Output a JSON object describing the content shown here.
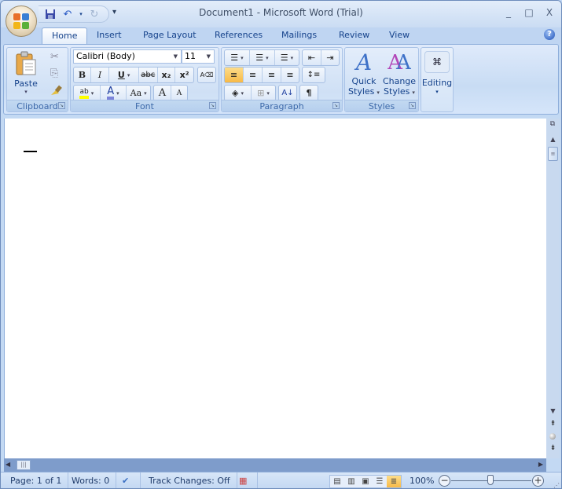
{
  "window": {
    "title": "Document1 - Microsoft Word (Trial)",
    "minimize": "_",
    "maximize": "□",
    "close": "X"
  },
  "qat": {
    "save": "save-icon",
    "undo": "undo-icon",
    "redo": "redo-icon",
    "customize": "▾"
  },
  "tabs": [
    "Home",
    "Insert",
    "Page Layout",
    "References",
    "Mailings",
    "Review",
    "View"
  ],
  "active_tab": "Home",
  "help": "?",
  "clipboard": {
    "label": "Clipboard",
    "paste": "Paste",
    "cut": "✂",
    "copy": "⎘",
    "format_painter": "🖌"
  },
  "font": {
    "label": "Font",
    "name": "Calibri (Body)",
    "size": "11",
    "bold": "B",
    "italic": "I",
    "underline": "U",
    "strike": "abc",
    "subscript": "x₂",
    "superscript": "x²",
    "clear": "A⌫",
    "highlight": "ab",
    "font_color": "A",
    "change_case": "Aa",
    "grow": "A",
    "shrink": "A",
    "highlight_color": "#ffff00",
    "font_color_value": "#7b83d9"
  },
  "paragraph": {
    "label": "Paragraph",
    "bullets": "☰",
    "numbering": "☰",
    "multilevel": "☰",
    "decrease_indent": "⇤",
    "increase_indent": "⇥",
    "align_left": "≡",
    "center": "≡",
    "align_right": "≡",
    "justify": "≡",
    "line_spacing": "↕≡",
    "shading": "◈",
    "borders": "⊞",
    "sort": "A↓",
    "pilcrow": "¶"
  },
  "styles": {
    "label": "Styles",
    "quick": "Quick",
    "quick2": "Styles",
    "change": "Change",
    "change2": "Styles"
  },
  "editing": {
    "label": "Editing"
  },
  "status": {
    "page": "Page: 1 of 1",
    "words": "Words: 0",
    "track": "Track Changes: Off",
    "zoom": "100%",
    "zoom_level": 100
  },
  "accent": "#f7b947"
}
